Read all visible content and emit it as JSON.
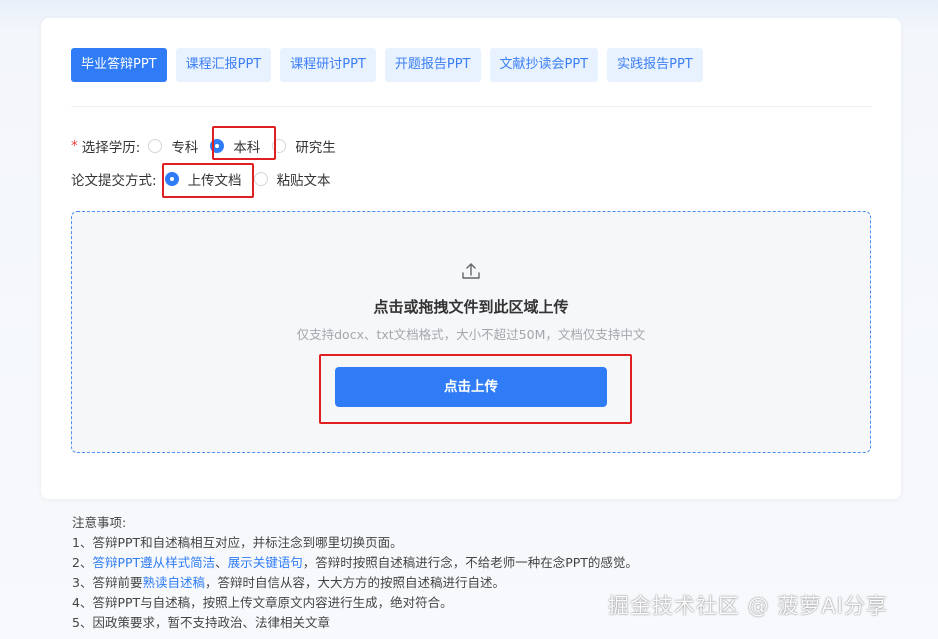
{
  "tabs": [
    "毕业答辩PPT",
    "课程汇报PPT",
    "课程研讨PPT",
    "开题报告PPT",
    "文献抄读会PPT",
    "实践报告PPT"
  ],
  "education": {
    "required_mark": "*",
    "label": "选择学历:",
    "options": [
      "专科",
      "本科",
      "研究生"
    ],
    "selected": "本科"
  },
  "submit_method": {
    "label": "论文提交方式:",
    "options": [
      "上传文档",
      "粘贴文本"
    ],
    "selected": "上传文档"
  },
  "upload": {
    "icon": "upload-icon",
    "title": "点击或拖拽文件到此区域上传",
    "subtitle": "仅支持docx、txt文档格式，大小不超过50M，文档仅支持中文",
    "button": "点击上传"
  },
  "notes": {
    "title": "注意事项:",
    "item1": "1、答辩PPT和自述稿相互对应，并标注念到哪里切换页面。",
    "item2_prefix": "2、",
    "item2_link1": "答辩PPT遵从样式简洁",
    "item2_sep": "、",
    "item2_link2": "展示关键语句",
    "item2_rest": "，答辩时按照自述稿进行念，不给老师一种在念PPT的感觉。",
    "item3_prefix": "3、答辩前要",
    "item3_link": "熟读自述稿",
    "item3_rest": "，答辩时自信从容，大大方方的按照自述稿进行自述。",
    "item4": "4、答辩PPT与自述稿，按照上传文章原文内容进行生成，绝对符合。",
    "item5": "5、因政策要求，暂不支持政治、法律相关文章"
  },
  "watermark": "掘金技术社区 @ 菠萝AI分享",
  "colors": {
    "primary": "#2f7cf6",
    "tab_bg": "#e8f1fe",
    "highlight": "#e02020"
  }
}
